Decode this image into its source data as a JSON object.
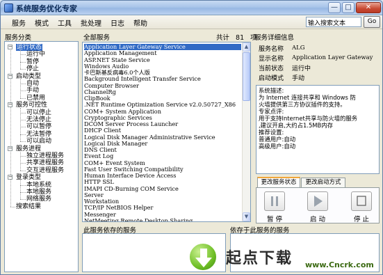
{
  "window": {
    "title": "系统服务优化专家"
  },
  "menu": {
    "items": [
      "服务",
      "模式",
      "工具",
      "批处理",
      "日志",
      "帮助"
    ]
  },
  "search": {
    "value": "输入搜索文本",
    "go_label": "Go"
  },
  "categories": {
    "title": "服务分类",
    "items": [
      {
        "label": "运行状态",
        "level": 0,
        "selected": true
      },
      {
        "label": "运行中",
        "level": 1
      },
      {
        "label": "暂停",
        "level": 1
      },
      {
        "label": "停止",
        "level": 1
      },
      {
        "label": "启动类型",
        "level": 0
      },
      {
        "label": "自动",
        "level": 1
      },
      {
        "label": "手动",
        "level": 1
      },
      {
        "label": "已禁用",
        "level": 1
      },
      {
        "label": "服务可控性",
        "level": 0
      },
      {
        "label": "可以停止",
        "level": 1
      },
      {
        "label": "无法停止",
        "level": 1
      },
      {
        "label": "可以暂停",
        "level": 1
      },
      {
        "label": "无法暂停",
        "level": 1
      },
      {
        "label": "可以启动",
        "level": 1
      },
      {
        "label": "服务进程",
        "level": 0
      },
      {
        "label": "独立进程服务",
        "level": 1
      },
      {
        "label": "共享进程服务",
        "level": 1
      },
      {
        "label": "交互进程服务",
        "level": 1
      },
      {
        "label": "登录类型",
        "level": 0
      },
      {
        "label": "本地系统",
        "level": 1
      },
      {
        "label": "本地服务",
        "level": 1
      },
      {
        "label": "网络服务",
        "level": 1
      },
      {
        "label": "搜索结果",
        "level": 0
      }
    ]
  },
  "services": {
    "title": "全部服务",
    "count_prefix": "共计",
    "count": "81",
    "count_suffix": "项",
    "items": [
      "Application Layer Gateway Service",
      "Application Management",
      "ASP.NET State Service",
      "Windows Audio",
      "卡巴斯基反病毒6.0个人版",
      "Background Intelligent Transfer Service",
      "Computer Browser",
      "ChannelRg",
      "ClipBook",
      ".NET Runtime Optimization Service v2.0.50727_X86",
      "COM+ System Application",
      "Cryptographic Services",
      "DCOM Server Process Launcher",
      "DHCP Client",
      "Logical Disk Manager Administrative Service",
      "Logical Disk Manager",
      "DNS Client",
      "Event Log",
      "COM+ Event System",
      "Fast User Switching Compatibility",
      "Human Interface Device Access",
      "HTTP SSL",
      "IMAPI CD-Burning COM Service",
      "Server",
      "Workstation",
      "TCP/IP NetBIOS Helper",
      "Messenger",
      "NetMeeting Remote Desktop Sharing"
    ]
  },
  "details": {
    "title": "服务详细信息",
    "fields": [
      {
        "label": "服务名称",
        "value": "ALG"
      },
      {
        "label": "显示名称",
        "value": "Application Layer Gateway"
      },
      {
        "label": "当前状态",
        "value": "运行中"
      },
      {
        "label": "启动模式",
        "value": "手动"
      }
    ],
    "description": [
      "系统描述:",
      "为 Internet 连接共享和 Windows 防",
      "火墙提供第三方协议插件的支持。",
      "专家点评:",
      "用于支持Internet共享与防火墙的服务",
      ",建议开启,大约占1.5MB内存",
      "推荐设置:",
      "普通用户:自动",
      "高级用户:自动"
    ]
  },
  "control_tabs": {
    "items": [
      "更改服务状态",
      "更改启动方式"
    ],
    "active": 0
  },
  "controls": {
    "pause_label": "暂 停",
    "start_label": "启 动",
    "stop_label": "停 止"
  },
  "dependencies": {
    "left_title": "此服务依存的服务",
    "right_title": "依存于此服务的服务"
  },
  "watermark": {
    "brand": "起点下载",
    "url": "www.Cncrk.com"
  }
}
